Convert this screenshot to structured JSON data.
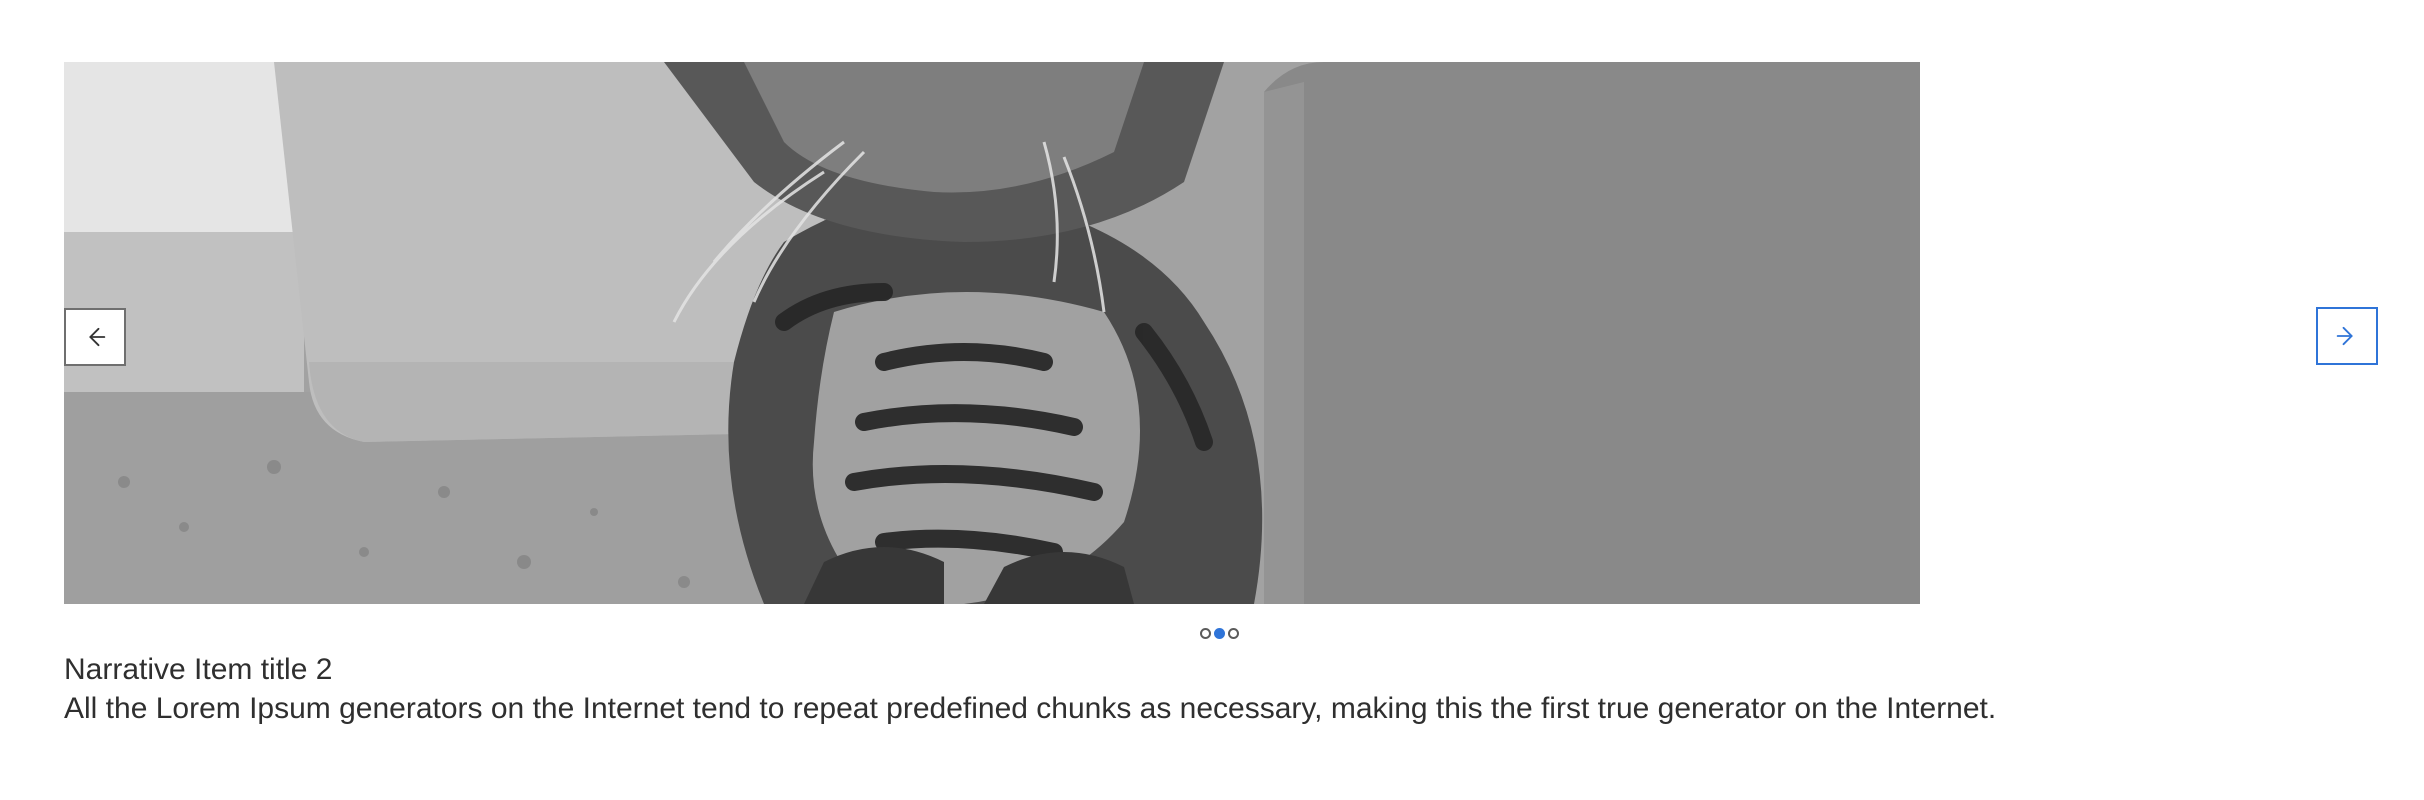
{
  "carousel": {
    "slide": {
      "title": "Narrative Item title 2",
      "description": "All the Lorem Ipsum generators on the Internet tend to repeat predefined chunks as necessary, making this the first true generator on the Internet."
    },
    "pagination": {
      "total": 3,
      "active_index": 2
    },
    "icons": {
      "prev": "arrow-left-icon",
      "next": "arrow-right-icon"
    },
    "colors": {
      "accent": "#2f74d8",
      "text": "#2f2f2f",
      "border": "#6b6b6b"
    }
  }
}
